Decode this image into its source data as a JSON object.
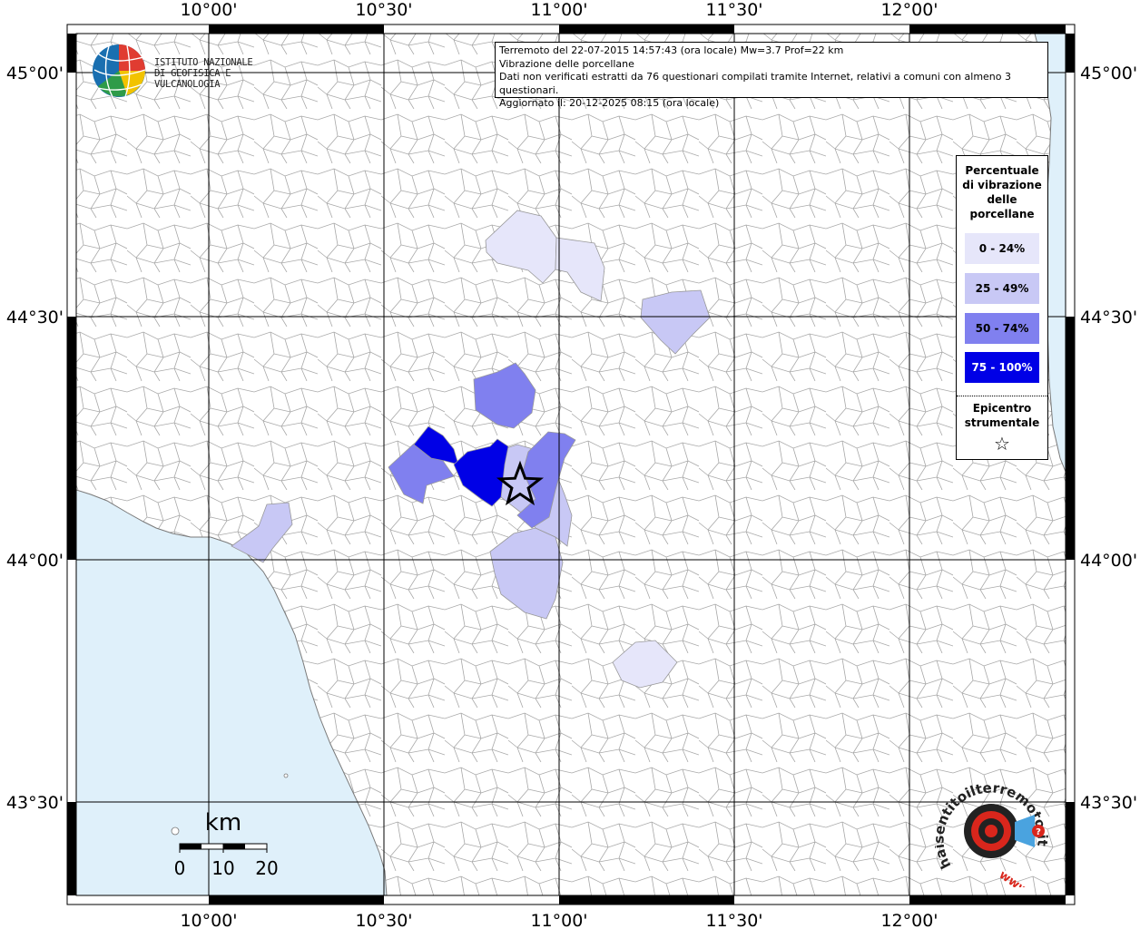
{
  "header": {
    "line1": "Terremoto del 22-07-2015 14:57:43 (ora locale) Mw=3.7 Prof=22 km",
    "line2": "Vibrazione delle porcellane",
    "line3": "Dati non verificati estratti da 76 questionari compilati tramite Internet, relativi a comuni con almeno 3 questionari.",
    "line4": "Aggiornato il: 20-12-2025 08:15 (ora locale)"
  },
  "logo_ingv": {
    "line1": "ISTITUTO NAZIONALE",
    "line2": "DI GEOFISICA E VULCANOLOGIA"
  },
  "axes": {
    "top_labels": [
      "10°00'",
      "10°30'",
      "11°00'",
      "11°30'",
      "12°00'"
    ],
    "bottom_labels": [
      "10°00'",
      "10°30'",
      "11°00'",
      "11°30'",
      "12°00'"
    ],
    "left_labels": [
      "45°00'",
      "44°30'",
      "44°00'",
      "43°30'"
    ],
    "right_labels": [
      "45°00'",
      "44°30'",
      "44°00'",
      "43°30'"
    ]
  },
  "legend": {
    "title_line1": "Percentuale",
    "title_line2": "di vibrazione",
    "title_line3": "delle",
    "title_line4": "porcellane",
    "classes": [
      {
        "label": "0 - 24%",
        "color": "#e6e6fa",
        "text_color": "#000000"
      },
      {
        "label": "25 - 49%",
        "color": "#c8c8f5",
        "text_color": "#000000"
      },
      {
        "label": "50 - 74%",
        "color": "#8080ef",
        "text_color": "#000000"
      },
      {
        "label": "75 - 100%",
        "color": "#0000e6",
        "text_color": "#ffffff"
      }
    ],
    "epicenter_line1": "Epicentro",
    "epicenter_line2": "strumentale",
    "epicenter_symbol": "☆"
  },
  "scale_bar": {
    "unit": "km",
    "labels": [
      "0",
      "10",
      "20"
    ]
  },
  "watermark": {
    "text": "haisentitoilterremoto.it",
    "prefix": "www."
  },
  "colors": {
    "sea": "#dff0fa",
    "land": "#ffffff",
    "boundary": "#9a9a9a",
    "grid": "#000000"
  },
  "icons": {
    "epicenter": "star-icon",
    "ingv_logo": "globe-icon",
    "hst_logo": "target-icon"
  }
}
